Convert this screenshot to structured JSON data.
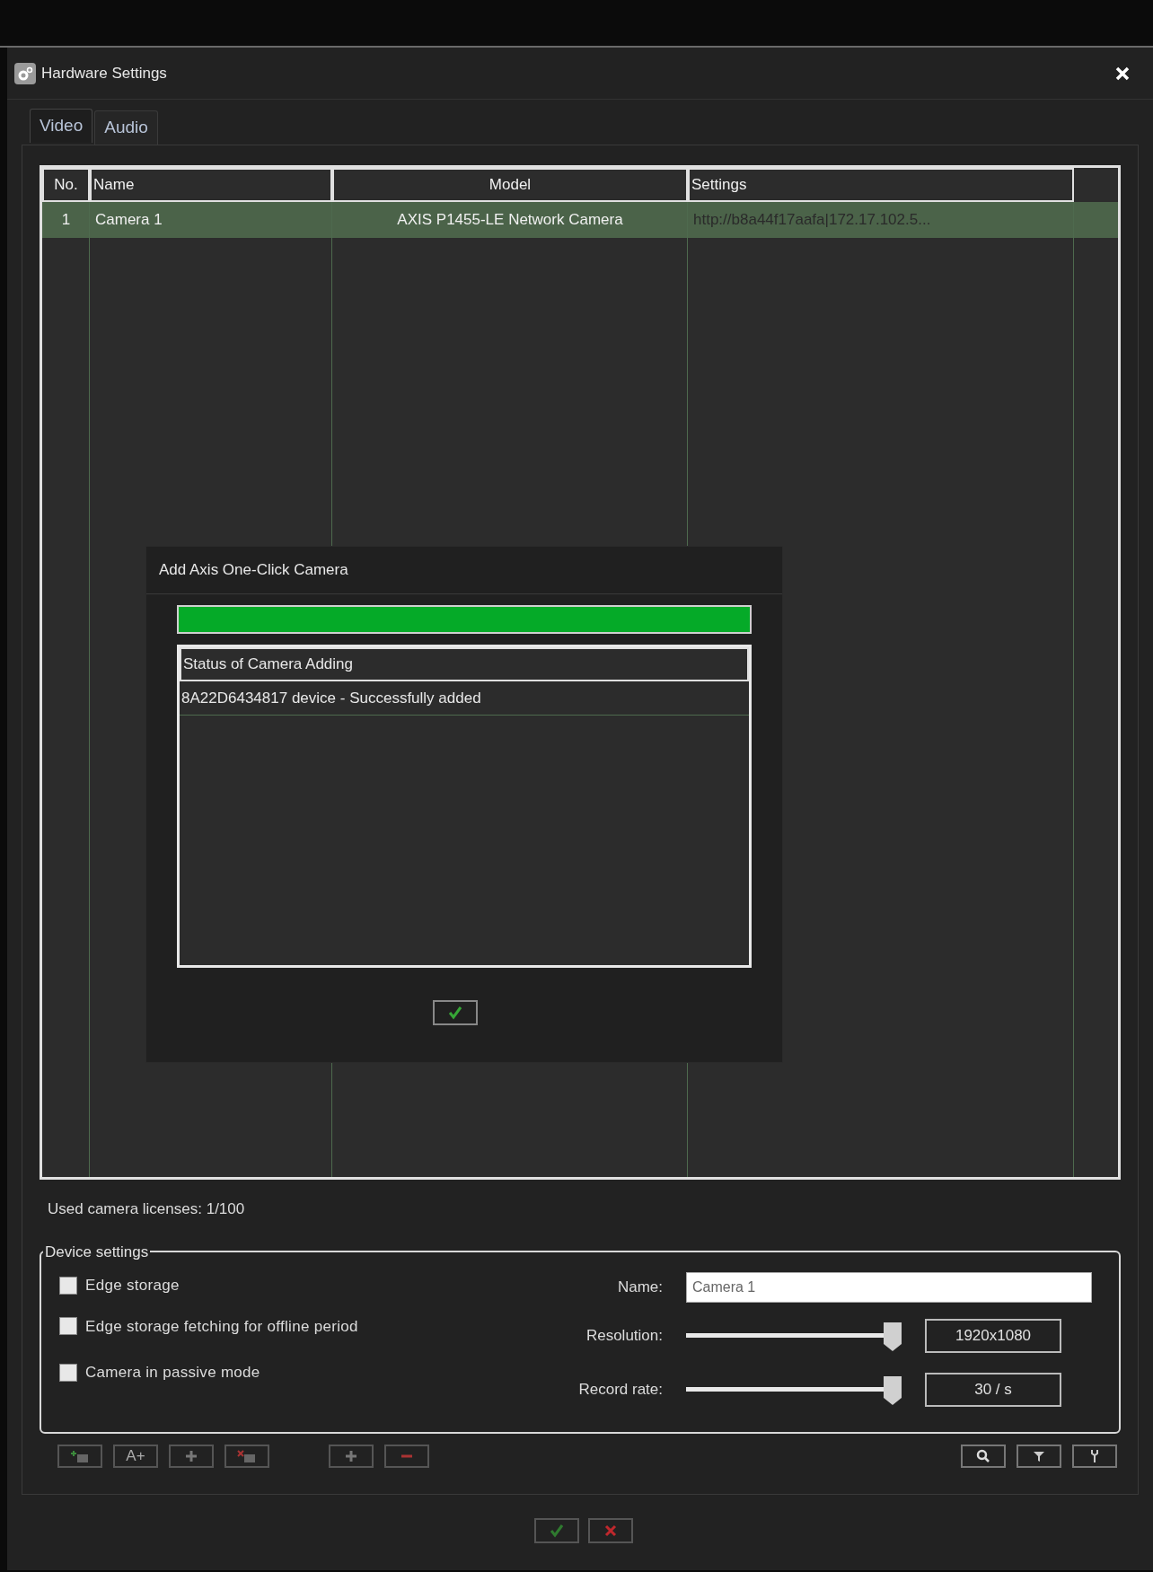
{
  "window": {
    "title": "Hardware Settings"
  },
  "tabs": [
    {
      "label": "Video",
      "selected": true
    },
    {
      "label": "Audio",
      "selected": false
    }
  ],
  "table": {
    "columns": [
      "No.",
      "Name",
      "Model",
      "Settings"
    ],
    "rows": [
      {
        "no": "1",
        "name": "Camera 1",
        "model": "AXIS P1455-LE Network Camera",
        "settings": "http://b8a44f17aafa|172.17.102.5...",
        "selected": true
      }
    ]
  },
  "dialog": {
    "title": "Add Axis One-Click Camera",
    "progress": {
      "level": 1
    },
    "status_header": "Status of Camera Adding",
    "status_rows": [
      "8A22D6434817 device - Successfully added"
    ]
  },
  "licenses": "Used camera licenses: 1/100",
  "device_settings": {
    "legend": "Device settings",
    "checkboxes": [
      {
        "label": "Edge storage",
        "checked": false
      },
      {
        "label": "Edge storage fetching for offline period",
        "checked": false
      },
      {
        "label": "Camera in passive mode",
        "checked": false
      }
    ],
    "name": {
      "label": "Name:",
      "value": "Camera 1"
    },
    "sliders": [
      {
        "label": "Resolution:",
        "level": 1,
        "reading": "1920x1080"
      },
      {
        "label": "Record rate:",
        "level": 1,
        "reading": "30 / s"
      }
    ]
  },
  "toolbar": {
    "text_button": "A+"
  }
}
